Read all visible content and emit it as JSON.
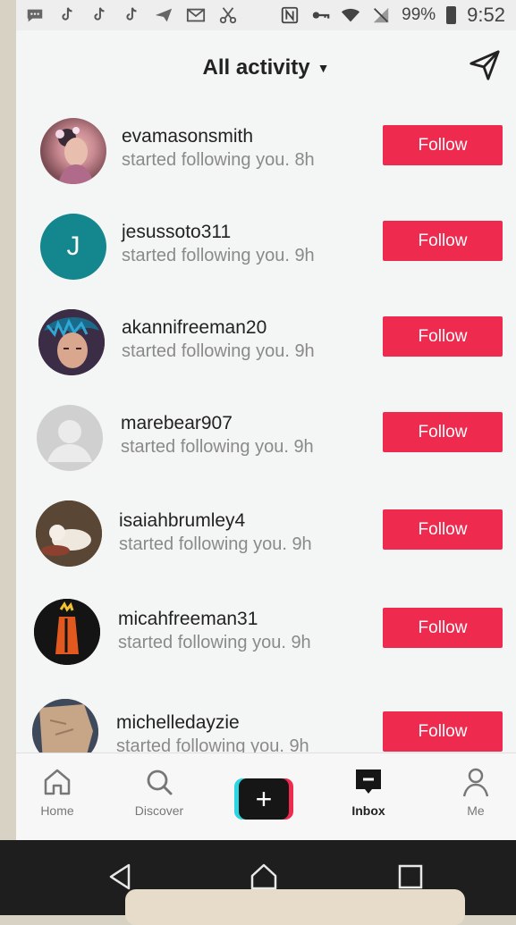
{
  "status_bar": {
    "battery": "99%",
    "time": "9:52",
    "icons": [
      "chat-icon",
      "tiktok-icon",
      "tiktok-icon",
      "tiktok-icon",
      "send-icon",
      "gmail-icon",
      "scissors-icon",
      "nfc-icon",
      "key-icon",
      "wifi-icon",
      "signal-off-icon",
      "battery-icon"
    ]
  },
  "header": {
    "title": "All activity",
    "dropdown_icon": "caret-down-icon",
    "action_icon": "paper-plane-icon"
  },
  "activities": [
    {
      "username": "evamasonsmith",
      "subtitle": "started following you. 8h",
      "button": "Follow",
      "avatar": "photo"
    },
    {
      "username": "jesussoto311",
      "subtitle": "started following you. 9h",
      "button": "Follow",
      "avatar": "initial",
      "initial": "J",
      "avatar_color": "#14868e"
    },
    {
      "username": "akannifreeman20",
      "subtitle": "started following you. 9h",
      "button": "Follow",
      "avatar": "photo"
    },
    {
      "username": "marebear907",
      "subtitle": "started following you. 9h",
      "button": "Follow",
      "avatar": "default"
    },
    {
      "username": "isaiahbrumley4",
      "subtitle": "started following you. 9h",
      "button": "Follow",
      "avatar": "photo"
    },
    {
      "username": "micahfreeman31",
      "subtitle": "started following you. 9h",
      "button": "Follow",
      "avatar": "photo"
    },
    {
      "username": "michelledayzie",
      "subtitle": "started following you. 9h",
      "button": "Follow",
      "avatar": "photo"
    }
  ],
  "tab_bar": {
    "home": "Home",
    "discover": "Discover",
    "create_icon": "plus-icon",
    "inbox": "Inbox",
    "me": "Me"
  },
  "colors": {
    "follow_button": "#ef2a4f",
    "create_cyan": "#2bd6e2",
    "create_red": "#ef2a4f"
  }
}
